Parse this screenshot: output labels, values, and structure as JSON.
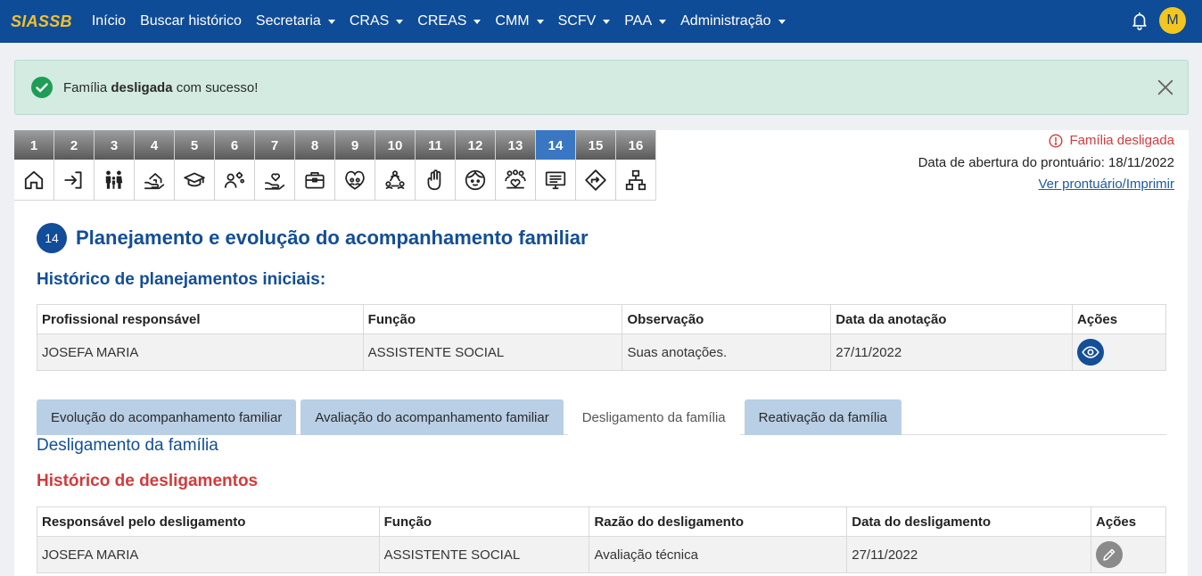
{
  "navbar": {
    "brand": "SIASSB",
    "items": [
      {
        "label": "Início",
        "dropdown": false
      },
      {
        "label": "Buscar histórico",
        "dropdown": false
      },
      {
        "label": "Secretaria",
        "dropdown": true
      },
      {
        "label": "CRAS",
        "dropdown": true
      },
      {
        "label": "CREAS",
        "dropdown": true
      },
      {
        "label": "CMM",
        "dropdown": true
      },
      {
        "label": "SCFV",
        "dropdown": true
      },
      {
        "label": "PAA",
        "dropdown": true
      },
      {
        "label": "Administração",
        "dropdown": true
      }
    ],
    "avatar_initial": "M",
    "bell_icon": "bell-icon"
  },
  "alert": {
    "prefix": "Família ",
    "bold": "desligada",
    "suffix": " com sucesso!",
    "icon": "check-circle-icon",
    "color": "#d3ebe1"
  },
  "steps": {
    "active": 14,
    "items": [
      {
        "num": "1",
        "icon": "home-icon"
      },
      {
        "num": "2",
        "icon": "login-icon"
      },
      {
        "num": "3",
        "icon": "family-icon"
      },
      {
        "num": "4",
        "icon": "house-hand-icon"
      },
      {
        "num": "5",
        "icon": "graduation-cap-icon"
      },
      {
        "num": "6",
        "icon": "person-gears-icon"
      },
      {
        "num": "7",
        "icon": "hand-heart-icon"
      },
      {
        "num": "8",
        "icon": "briefcase-icon"
      },
      {
        "num": "9",
        "icon": "group-heart-icon"
      },
      {
        "num": "10",
        "icon": "people-network-icon"
      },
      {
        "num": "11",
        "icon": "hand-stop-icon"
      },
      {
        "num": "12",
        "icon": "face-icon"
      },
      {
        "num": "13",
        "icon": "group-care-icon"
      },
      {
        "num": "14",
        "icon": "monitor-list-icon"
      },
      {
        "num": "15",
        "icon": "direction-sign-icon"
      },
      {
        "num": "16",
        "icon": "hierarchy-icon"
      }
    ]
  },
  "info": {
    "status": "Família desligada",
    "opening_date": "Data de abertura do prontuário: 18/11/2022",
    "print_link": "Ver prontuário/Imprimir"
  },
  "main": {
    "badge": "14",
    "title": "Planejamento e evolução do acompanhamento familiar",
    "subtitle": "Histórico de planejamentos iniciais:",
    "plans_table": {
      "headers": [
        "Profissional responsável",
        "Função",
        "Observação",
        "Data da anotação",
        "Ações"
      ],
      "rows": [
        [
          "JOSEFA MARIA",
          "ASSISTENTE SOCIAL",
          "Suas anotações.",
          "27/11/2022"
        ]
      ]
    },
    "tabs": [
      {
        "label": "Evolução do acompanhamento familiar",
        "active": false
      },
      {
        "label": "Avaliação do acompanhamento familiar",
        "active": false
      },
      {
        "label": "Desligamento da família",
        "active": true
      },
      {
        "label": "Reativação da família",
        "active": false
      }
    ],
    "section_title": "Desligamento da família",
    "history_title": "Histórico de desligamentos",
    "dismissal_table": {
      "headers": [
        "Responsável pelo desligamento",
        "Função",
        "Razão do desligamento",
        "Data do desligamento",
        "Ações"
      ],
      "rows": [
        [
          "JOSEFA MARIA",
          "ASSISTENTE SOCIAL",
          "Avaliação técnica",
          "27/11/2022"
        ]
      ]
    }
  },
  "colors": {
    "navbar": "#0f4c97",
    "brand": "#f2c12e",
    "accent": "#134e96",
    "danger": "#d23b3b",
    "tab_inactive": "#b9cfe6"
  }
}
